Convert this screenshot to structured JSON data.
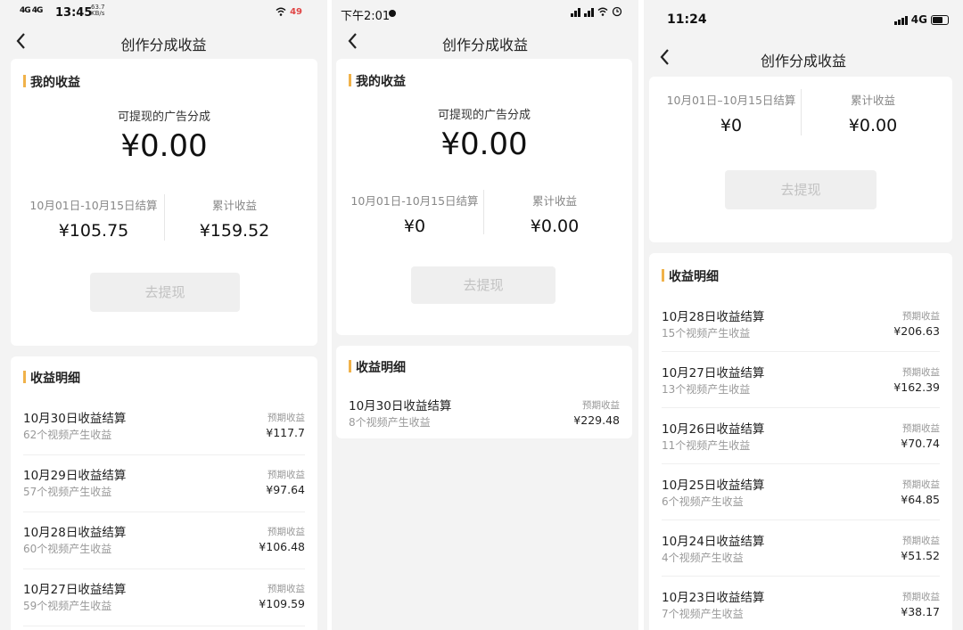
{
  "screens": [
    {
      "status": {
        "time": "13:45",
        "signal": "4G 4G",
        "net_speed_value": "63.7",
        "net_speed_unit": "KB/s",
        "battery": "49"
      },
      "nav_title": "创作分成收益",
      "section_title": "我的收益",
      "withdraw_label": "可提现的广告分成",
      "withdraw_amount": "¥0.00",
      "period_label": "10月01日-10月15日结算",
      "period_amount": "¥105.75",
      "total_label": "累计收益",
      "total_amount": "¥159.52",
      "button_label": "去提现",
      "detail_title": "收益明细",
      "rows": [
        {
          "title": "10月30日收益结算",
          "sub": "62个视频产生收益",
          "exp_label": "预期收益",
          "amount": "¥117.7"
        },
        {
          "title": "10月29日收益结算",
          "sub": "57个视频产生收益",
          "exp_label": "预期收益",
          "amount": "¥97.64"
        },
        {
          "title": "10月28日收益结算",
          "sub": "60个视频产生收益",
          "exp_label": "预期收益",
          "amount": "¥106.48"
        },
        {
          "title": "10月27日收益结算",
          "sub": "59个视频产生收益",
          "exp_label": "预期收益",
          "amount": "¥109.59"
        }
      ]
    },
    {
      "status": {
        "time": "下午2:01"
      },
      "nav_title": "创作分成收益",
      "section_title": "我的收益",
      "withdraw_label": "可提现的广告分成",
      "withdraw_amount": "¥0.00",
      "period_label": "10月01日-10月15日结算",
      "period_amount": "¥0",
      "total_label": "累计收益",
      "total_amount": "¥0.00",
      "button_label": "去提现",
      "detail_title": "收益明细",
      "rows": [
        {
          "title": "10月30日收益结算",
          "sub": "8个视频产生收益",
          "exp_label": "预期收益",
          "amount": "¥229.48"
        }
      ]
    },
    {
      "status": {
        "time": "11:24",
        "network": "4G"
      },
      "nav_title": "创作分成收益",
      "period_label": "10月01日–10月15日结算",
      "period_amount": "¥0",
      "total_label": "累计收益",
      "total_amount": "¥0.00",
      "button_label": "去提现",
      "detail_title": "收益明细",
      "rows": [
        {
          "title": "10月28日收益结算",
          "sub": "15个视频产生收益",
          "exp_label": "预期收益",
          "amount": "¥206.63"
        },
        {
          "title": "10月27日收益结算",
          "sub": "13个视频产生收益",
          "exp_label": "预期收益",
          "amount": "¥162.39"
        },
        {
          "title": "10月26日收益结算",
          "sub": "11个视频产生收益",
          "exp_label": "预期收益",
          "amount": "¥70.74"
        },
        {
          "title": "10月25日收益结算",
          "sub": "6个视频产生收益",
          "exp_label": "预期收益",
          "amount": "¥64.85"
        },
        {
          "title": "10月24日收益结算",
          "sub": "4个视频产生收益",
          "exp_label": "预期收益",
          "amount": "¥51.52"
        },
        {
          "title": "10月23日收益结算",
          "sub": "7个视频产生收益",
          "exp_label": "预期收益",
          "amount": "¥38.17"
        }
      ]
    }
  ]
}
